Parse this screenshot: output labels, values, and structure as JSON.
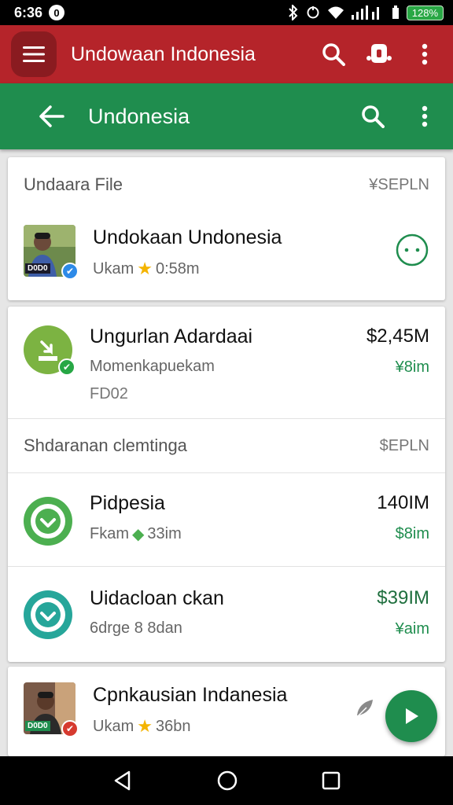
{
  "status": {
    "time": "6:36",
    "notification_glyph": "0",
    "battery": "128%"
  },
  "appbar_primary": {
    "title": "Undowaan Indonesia"
  },
  "appbar_secondary": {
    "title": "Undonesia"
  },
  "section_file": {
    "header": "Undaara File",
    "header_tag": "¥SEPLN",
    "item": {
      "title": "Undokaan Undonesia",
      "subtitle_prefix": "Ukam",
      "subtitle_value": "0:58m",
      "photo_label": "D0D0"
    }
  },
  "transactions": [
    {
      "title": "Ungurlan Adardaai",
      "subtitle": "Momenkapuekam",
      "detail": "FD02",
      "amount": "$2,45M",
      "subamount": "¥8im",
      "icon_color": "#7cb342"
    }
  ],
  "section_shared": {
    "header": "Shdaranan clemtinga",
    "header_tag": "$EPLN"
  },
  "shared_items": [
    {
      "title": "Pidpesia",
      "subtitle_prefix": "Fkam",
      "subtitle_value": "33im",
      "amount": "140IM",
      "subamount": "$8im",
      "icon_color": "#4caf50"
    },
    {
      "title": "Uidacloan ckan",
      "subtitle": "6drge 8 8dan",
      "amount": "$39IM",
      "subamount": "¥aim",
      "icon_color": "#26a69a"
    }
  ],
  "last_item": {
    "title": "Cpnkausian Indanesia",
    "subtitle_prefix": "Ukam",
    "subtitle_value": "36bn",
    "photo_label": "D0D0"
  },
  "colors": {
    "red_bar": "#b5242a",
    "green_bar": "#1f8d4e"
  }
}
